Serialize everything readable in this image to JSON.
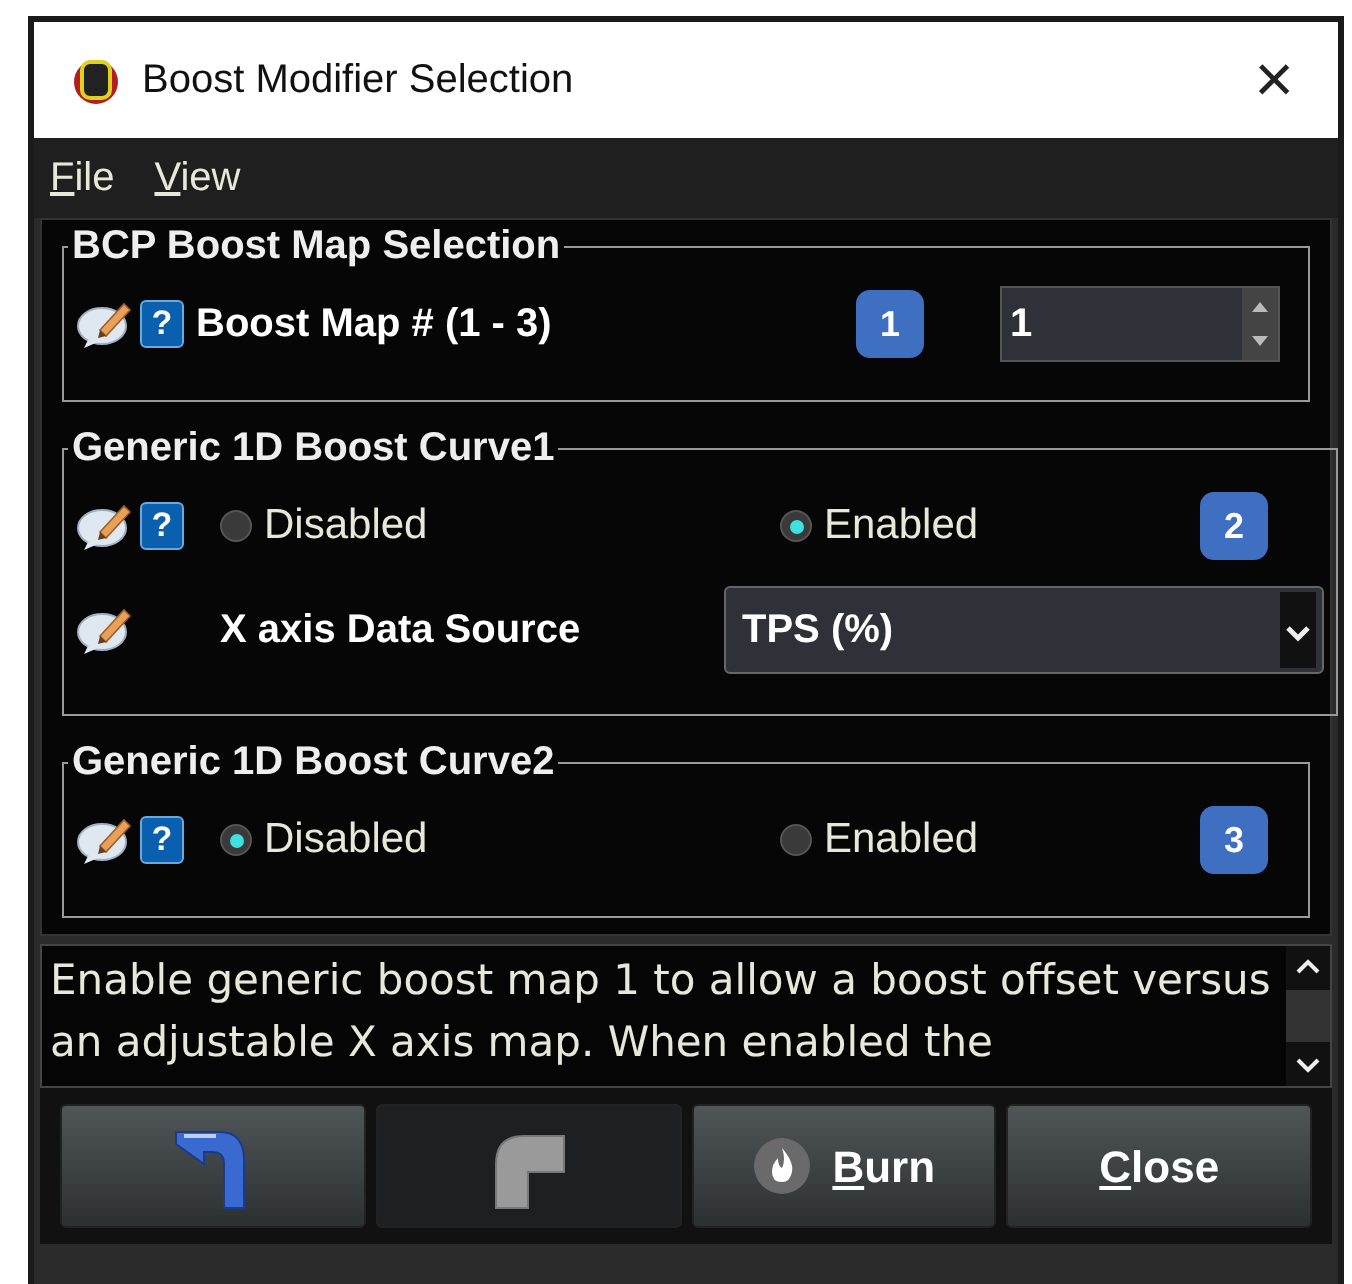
{
  "window": {
    "title": "Boost Modifier Selection",
    "close": "×"
  },
  "menu": [
    {
      "label": "File",
      "mnemonic": true
    },
    {
      "label": "View",
      "mnemonic": true
    }
  ],
  "sections": [
    {
      "title": "BCP Boost Map Selection",
      "rows": [
        {
          "kind": "number",
          "help": "?",
          "label": "Boost Map # (1 - 3)",
          "badge": "1",
          "value": "1"
        }
      ]
    },
    {
      "title": "Generic 1D Boost Curve1",
      "rows": [
        {
          "kind": "radio",
          "help": "?",
          "options": [
            {
              "label": "Disabled",
              "selected": false
            },
            {
              "label": "Enabled",
              "selected": true
            }
          ],
          "badge": "2"
        },
        {
          "kind": "select",
          "label": "X axis Data Source",
          "value": "TPS (%)"
        }
      ]
    },
    {
      "title": "Generic 1D Boost Curve2",
      "rows": [
        {
          "kind": "radio",
          "help": "?",
          "options": [
            {
              "label": "Disabled",
              "selected": true
            },
            {
              "label": "Enabled",
              "selected": false
            }
          ],
          "badge": "3"
        }
      ]
    }
  ],
  "help_text": "Enable generic boost map 1 to allow a boost offset versus an adjustable X axis map. When enabled the",
  "buttons": [
    {
      "kind": "undo",
      "disabled": false
    },
    {
      "kind": "redo",
      "disabled": true
    },
    {
      "kind": "burn",
      "label": "Burn",
      "mnemonic": true,
      "disabled": false
    },
    {
      "kind": "text",
      "label": "Close",
      "mnemonic": true,
      "disabled": false
    }
  ]
}
